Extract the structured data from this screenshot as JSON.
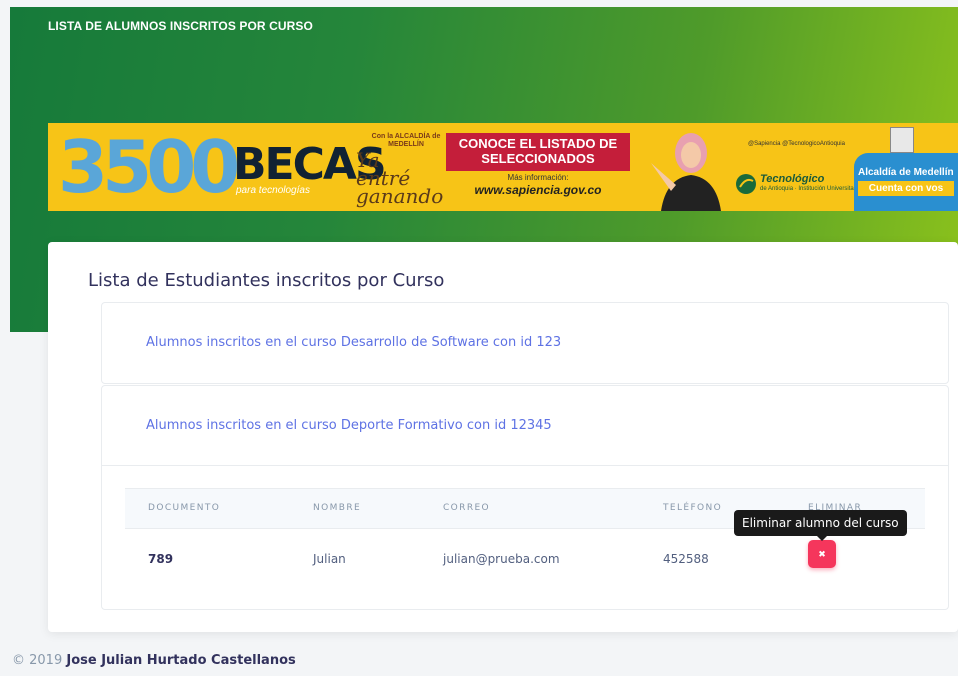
{
  "header": {
    "title": "LISTA DE ALUMNOS INSCRITOS POR CURSO"
  },
  "banner": {
    "number": "3500",
    "becas": "BECAS",
    "tecnologias": "para tecnologías",
    "alcaldia_small": "Con la ALCALDÍA de MEDELLÍN",
    "ya_entre": "Ya entré ganando",
    "box_title": "CONOCE EL LISTADO DE SELECCIONADOS",
    "mas_info": "Más información:",
    "url": "www.sapiencia.gov.co",
    "social": "@Sapiencia  @TecnologicoAntioquia",
    "tecnologico": "Tecnológico",
    "tecnologico_sub": "de Antioquia · Institución Universitaria",
    "alcaldia": "Alcaldía de Medellín",
    "cuenta": "Cuenta con vos"
  },
  "card": {
    "title": "Lista de Estudiantes inscritos por Curso",
    "courses": [
      {
        "label": "Alumnos inscritos en el curso Desarrollo de Software con id 123"
      },
      {
        "label": "Alumnos inscritos en el curso Deporte Formativo con id 12345"
      }
    ],
    "table": {
      "headers": [
        "DOCUMENTO",
        "NOMBRE",
        "CORREO",
        "TELÉFONO",
        "ELIMINAR"
      ],
      "rows": [
        {
          "documento": "789",
          "nombre": "Julian",
          "correo": "julian@prueba.com",
          "telefono": "452588"
        }
      ]
    },
    "delete_icon": "times-icon",
    "delete_tooltip": "Eliminar alumno del curso"
  },
  "footer": {
    "copyright": "© 2019",
    "author": "Jose Julian Hurtado Castellanos"
  },
  "colors": {
    "accent": "#5e72e4",
    "danger": "#f5365c",
    "header_start": "#167a3a",
    "header_end": "#8cc21c",
    "banner_bg": "#f7c417"
  }
}
